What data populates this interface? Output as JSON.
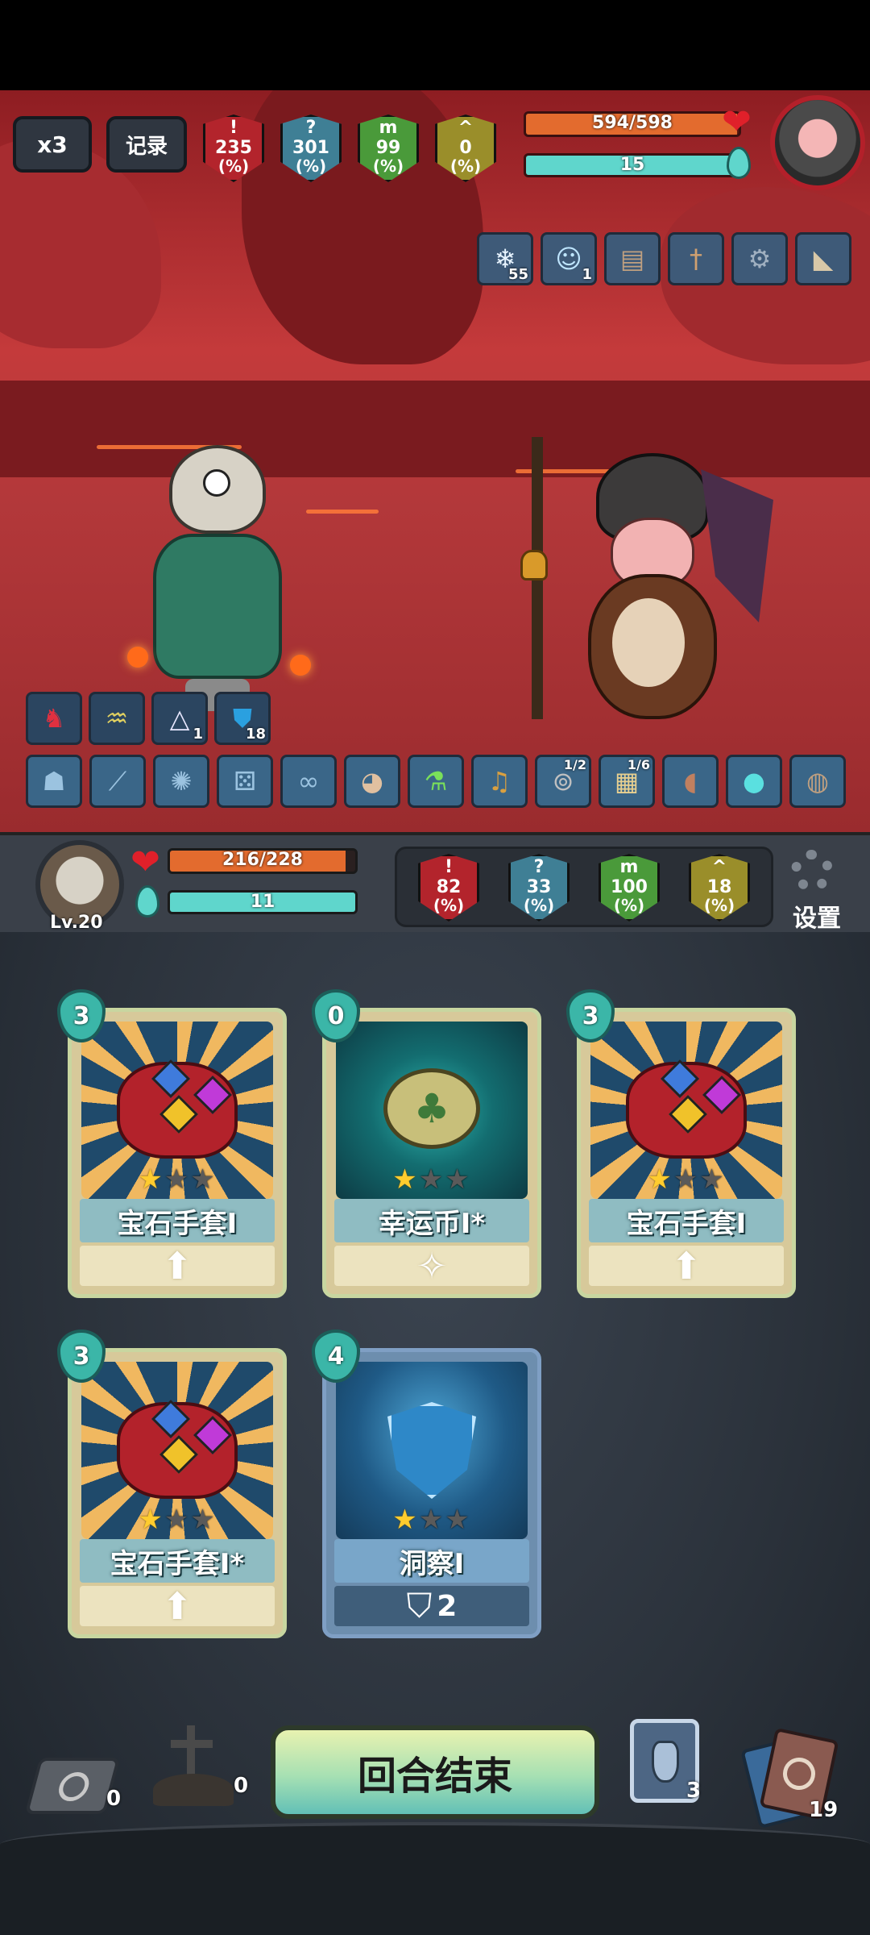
{
  "top_bar": {
    "speed_label": "x3",
    "log_label": "记录"
  },
  "enemy": {
    "stats": [
      {
        "icon": "attack-icon",
        "glyph": "!",
        "value": "235",
        "unit": "(%)",
        "color": "#b3242c"
      },
      {
        "icon": "question-icon",
        "glyph": "?",
        "value": "301",
        "unit": "(%)",
        "color": "#3f7f95"
      },
      {
        "icon": "defense-icon",
        "glyph": "m",
        "value": "99",
        "unit": "(%)",
        "color": "#4a9a3a"
      },
      {
        "icon": "speed-icon",
        "glyph": "^",
        "value": "0",
        "unit": "(%)",
        "color": "#9a8e2a"
      }
    ],
    "hp": "594/598",
    "hp_fraction": 0.993,
    "energy": "15",
    "energy_fraction": 1.0,
    "buffs": [
      {
        "icon": "snowflake-icon",
        "count": "55"
      },
      {
        "icon": "ghost-icon",
        "count": "1"
      },
      {
        "icon": "book-icon",
        "count": ""
      },
      {
        "icon": "dagger-icon",
        "count": ""
      },
      {
        "icon": "gear-orb-icon",
        "count": ""
      },
      {
        "icon": "horn-icon",
        "count": ""
      }
    ]
  },
  "player": {
    "level": "Lv.20",
    "hp": "216/228",
    "hp_fraction": 0.947,
    "energy": "11",
    "energy_fraction": 1.0,
    "stats": [
      {
        "icon": "attack-icon",
        "glyph": "!",
        "value": "82",
        "unit": "(%)",
        "color": "#b3242c"
      },
      {
        "icon": "question-icon",
        "glyph": "?",
        "value": "33",
        "unit": "(%)",
        "color": "#3f7f95"
      },
      {
        "icon": "defense-icon",
        "glyph": "m",
        "value": "100",
        "unit": "(%)",
        "color": "#4a9a3a"
      },
      {
        "icon": "speed-icon",
        "glyph": "^",
        "value": "18",
        "unit": "(%)",
        "color": "#9a8e2a"
      }
    ],
    "settings_label": "设置",
    "buffs": [
      {
        "icon": "red-figure-icon",
        "count": ""
      },
      {
        "icon": "swan-lamp-icon",
        "count": ""
      },
      {
        "icon": "prism-icon",
        "count": "1"
      },
      {
        "icon": "shield-icon",
        "count": "18"
      }
    ],
    "relics": [
      {
        "icon": "demon-mask-icon",
        "frac": ""
      },
      {
        "icon": "staff-icon",
        "frac": ""
      },
      {
        "icon": "splat-icon",
        "frac": ""
      },
      {
        "icon": "dice-icon",
        "frac": ""
      },
      {
        "icon": "dna-icon",
        "frac": ""
      },
      {
        "icon": "hamster-icon",
        "frac": ""
      },
      {
        "icon": "potion-icon",
        "frac": ""
      },
      {
        "icon": "bell-icon",
        "frac": ""
      },
      {
        "icon": "binoculars-icon",
        "frac": "1/2"
      },
      {
        "icon": "scroll-icon",
        "frac": "1/6"
      },
      {
        "icon": "meat-icon",
        "frac": ""
      },
      {
        "icon": "orb-icon",
        "frac": ""
      },
      {
        "icon": "pouch-icon",
        "frac": ""
      }
    ]
  },
  "hand": [
    {
      "cost": "3",
      "name": "宝石手套I",
      "stars": 1,
      "art": "fist",
      "footer": "up-arrow-icon"
    },
    {
      "cost": "0",
      "name": "幸运币I*",
      "stars": 1,
      "art": "coin",
      "footer": "spark-icon"
    },
    {
      "cost": "3",
      "name": "宝石手套I",
      "stars": 1,
      "art": "fist",
      "footer": "up-arrow-icon"
    },
    {
      "cost": "3",
      "name": "宝石手套I*",
      "stars": 1,
      "art": "fist",
      "footer": "up-arrow-icon"
    },
    {
      "cost": "4",
      "name": "洞察I",
      "stars": 1,
      "art": "shield",
      "footer_value": "2"
    }
  ],
  "bottom": {
    "exhaust_count": "0",
    "grave_count": "0",
    "end_turn_label": "回合结束",
    "potion_count": "3",
    "draw_count": "19"
  }
}
